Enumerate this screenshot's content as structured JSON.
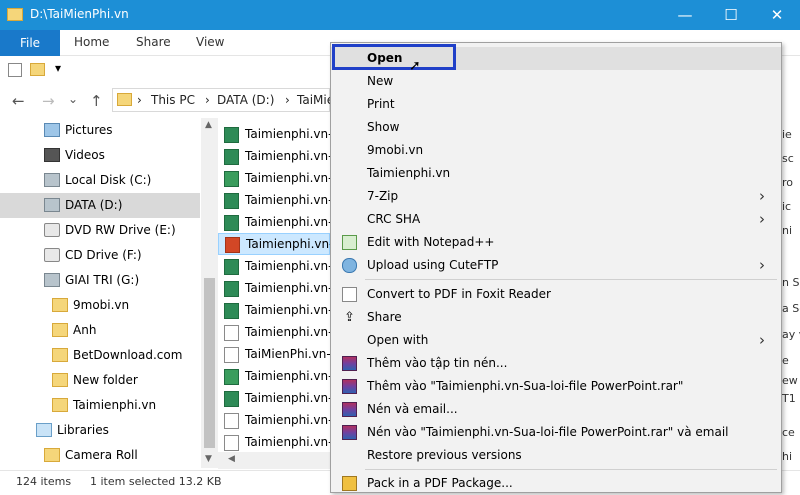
{
  "window": {
    "title": "D:\\TaiMienPhi.vn",
    "minimize": "—",
    "maximize": "☐",
    "close": "✕"
  },
  "ribbon": {
    "file": "File",
    "home": "Home",
    "share": "Share",
    "view": "View"
  },
  "address": {
    "back": "←",
    "forward": "→",
    "dropdown": "⌄",
    "up": "↑",
    "crumbs": [
      "This PC",
      "DATA (D:)",
      "TaiMie"
    ],
    "separator": "›"
  },
  "nav": {
    "items": [
      {
        "label": "Pictures",
        "icon": "pictures-icon"
      },
      {
        "label": "Videos",
        "icon": "videos-icon"
      },
      {
        "label": "Local Disk (C:)",
        "icon": "local-disk-icon"
      },
      {
        "label": "DATA (D:)",
        "icon": "drive-icon",
        "selected": true
      },
      {
        "label": "DVD RW Drive (E:)",
        "icon": "dvd-icon"
      },
      {
        "label": "CD Drive (F:)",
        "icon": "cd-icon"
      },
      {
        "label": "GIAI TRI (G:)",
        "icon": "drive-icon"
      },
      {
        "label": "9mobi.vn",
        "icon": "folder-icon"
      },
      {
        "label": "Anh",
        "icon": "folder-icon"
      },
      {
        "label": "BetDownload.com",
        "icon": "folder-icon"
      },
      {
        "label": "New folder",
        "icon": "folder-icon"
      },
      {
        "label": "Taimienphi.vn",
        "icon": "folder-icon"
      },
      {
        "label": "Libraries",
        "icon": "libraries-icon"
      },
      {
        "label": "Camera Roll",
        "icon": "folder-icon"
      }
    ]
  },
  "files": {
    "rows": [
      {
        "name": "Taimienphi.vn-",
        "type": "xls"
      },
      {
        "name": "Taimienphi.vn-",
        "type": "xls"
      },
      {
        "name": "Taimienphi.vn-",
        "type": "xlsg"
      },
      {
        "name": "Taimienphi.vn-",
        "type": "xls"
      },
      {
        "name": "Taimienphi.vn-",
        "type": "xls"
      },
      {
        "name": "Taimienphi.vn-",
        "type": "ppt",
        "selected": true
      },
      {
        "name": "Taimienphi.vn-",
        "type": "xls"
      },
      {
        "name": "Taimienphi.vn-",
        "type": "xls"
      },
      {
        "name": "Taimienphi.vn-",
        "type": "xls"
      },
      {
        "name": "Taimienphi.vn-",
        "type": "txt"
      },
      {
        "name": "TaiMienPhi.vn-",
        "type": "txt"
      },
      {
        "name": "Taimienphi.vn-",
        "type": "xlsg"
      },
      {
        "name": "Taimienphi.vn-",
        "type": "xls"
      },
      {
        "name": "Taimienphi.vn-",
        "type": "txt"
      },
      {
        "name": "Taimienphi.vn-",
        "type": "txt"
      }
    ]
  },
  "status": {
    "count": "124 items",
    "selected": "1 item selected  13.2 KB"
  },
  "right_strip": [
    "ie",
    "sc",
    "ro",
    "ic",
    "ni",
    "",
    "n Sa",
    "a Se",
    "ay v",
    "e",
    "ew",
    "T1",
    "ce",
    "hi"
  ],
  "context_menu": {
    "items": [
      {
        "label": "Open",
        "bold": true,
        "hover": true
      },
      {
        "label": "New"
      },
      {
        "label": "Print"
      },
      {
        "label": "Show"
      },
      {
        "label": "9mobi.vn"
      },
      {
        "label": "Taimienphi.vn"
      },
      {
        "label": "7-Zip",
        "submenu": true
      },
      {
        "label": "CRC SHA",
        "submenu": true
      },
      {
        "label": "Edit with Notepad++",
        "icon": "notepad-icon"
      },
      {
        "label": "Upload using CuteFTP",
        "icon": "cuteftp-icon",
        "submenu": true
      },
      {
        "label": "Convert to PDF in Foxit Reader",
        "icon": "foxit-icon",
        "sep_before": true
      },
      {
        "label": "Share",
        "icon": "share-icon"
      },
      {
        "label": "Open with",
        "submenu": true
      },
      {
        "label": "Thêm vào tập tin nén...",
        "icon": "winrar-icon"
      },
      {
        "label": "Thêm vào \"Taimienphi.vn-Sua-loi-file PowerPoint.rar\"",
        "icon": "winrar-icon"
      },
      {
        "label": "Nén và email...",
        "icon": "winrar-icon"
      },
      {
        "label": "Nén vào \"Taimienphi.vn-Sua-loi-file PowerPoint.rar\" và email",
        "icon": "winrar-icon"
      },
      {
        "label": "Restore previous versions"
      },
      {
        "label": "Pack in a PDF Package...",
        "icon": "pdf-package-icon",
        "sep_before": true
      }
    ],
    "submenu_arrow": "›"
  },
  "colors": {
    "titlebar": "#1d8fd6",
    "file_tab": "#1979ca",
    "highlight": "#2040c8"
  }
}
